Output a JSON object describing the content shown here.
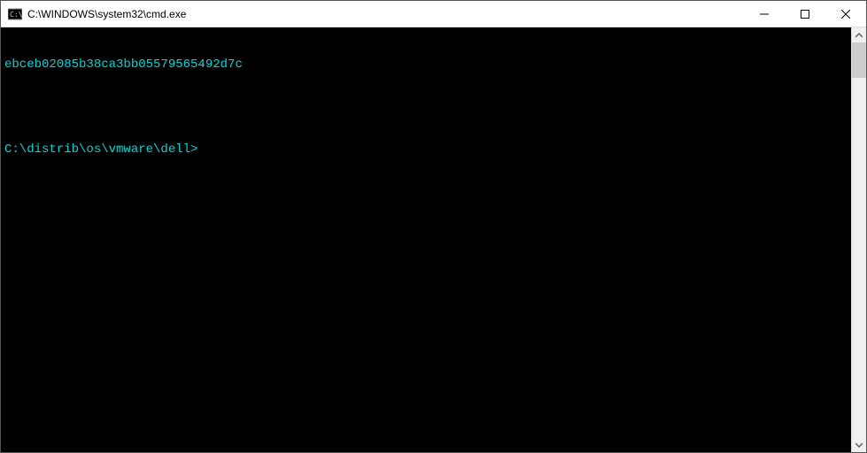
{
  "window": {
    "title": "C:\\WINDOWS\\system32\\cmd.exe"
  },
  "terminal": {
    "line1": "ebceb02085b38ca3bb05579565492d7c",
    "prompt": "C:\\distrib\\os\\vmware\\dell>"
  },
  "colors": {
    "terminal_bg": "#000000",
    "terminal_fg": "#00d7d7"
  }
}
